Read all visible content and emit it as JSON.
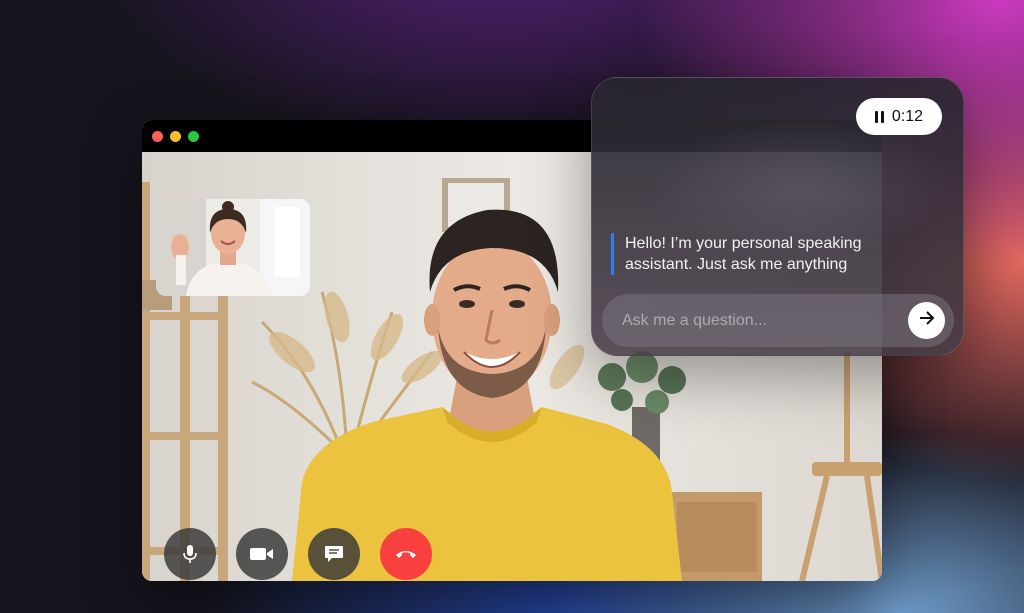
{
  "window": {
    "traffic_lights": [
      "close",
      "minimize",
      "zoom"
    ],
    "colors": {
      "close": "#ff5f57",
      "minimize": "#febc2e",
      "zoom": "#28c840"
    }
  },
  "call": {
    "main_participant": "man-in-yellow-shirt",
    "self_view": "woman-waving",
    "controls": [
      {
        "name": "microphone",
        "icon": "mic-icon"
      },
      {
        "name": "camera",
        "icon": "video-camera-icon"
      },
      {
        "name": "chat",
        "icon": "chat-bubble-icon"
      },
      {
        "name": "end-call",
        "icon": "phone-hangup-icon",
        "color": "#f8413f"
      }
    ]
  },
  "assistant": {
    "timer": "0:12",
    "timer_icon": "pause-icon",
    "message": "Hello! I’m your personal speaking assistant. Just ask me anything",
    "input_placeholder": "Ask me a question...",
    "send_icon": "arrow-right-icon",
    "accent": "#2f7cf6"
  }
}
